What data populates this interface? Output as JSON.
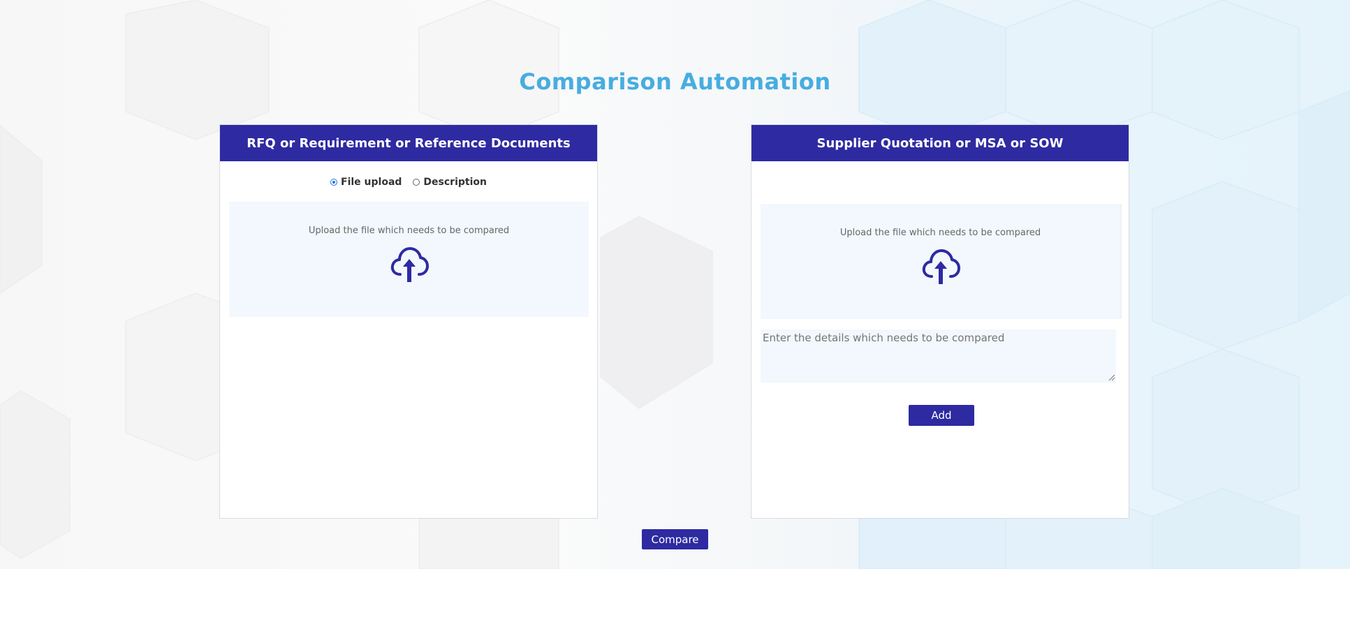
{
  "page": {
    "title": "Comparison Automation"
  },
  "left_panel": {
    "header": "RFQ or Requirement or Reference Documents",
    "radio_options": [
      {
        "label": "File upload",
        "checked": true
      },
      {
        "label": "Description",
        "checked": false
      }
    ],
    "dropzone_text": "Upload the file which needs to be compared",
    "dropzone_icon": "cloud-upload-icon"
  },
  "right_panel": {
    "header": "Supplier Quotation or MSA or SOW",
    "dropzone_text": "Upload the file which needs to be compared",
    "dropzone_icon": "cloud-upload-icon",
    "textarea_placeholder": "Enter the details which needs to be compared",
    "add_label": "Add"
  },
  "actions": {
    "compare_label": "Compare"
  },
  "colors": {
    "title": "#47ade0",
    "header_bg": "#2e2aa1",
    "button_bg": "#2e2aa1",
    "dropzone_bg": "#f2f8fd",
    "icon": "#2e2aa1"
  }
}
